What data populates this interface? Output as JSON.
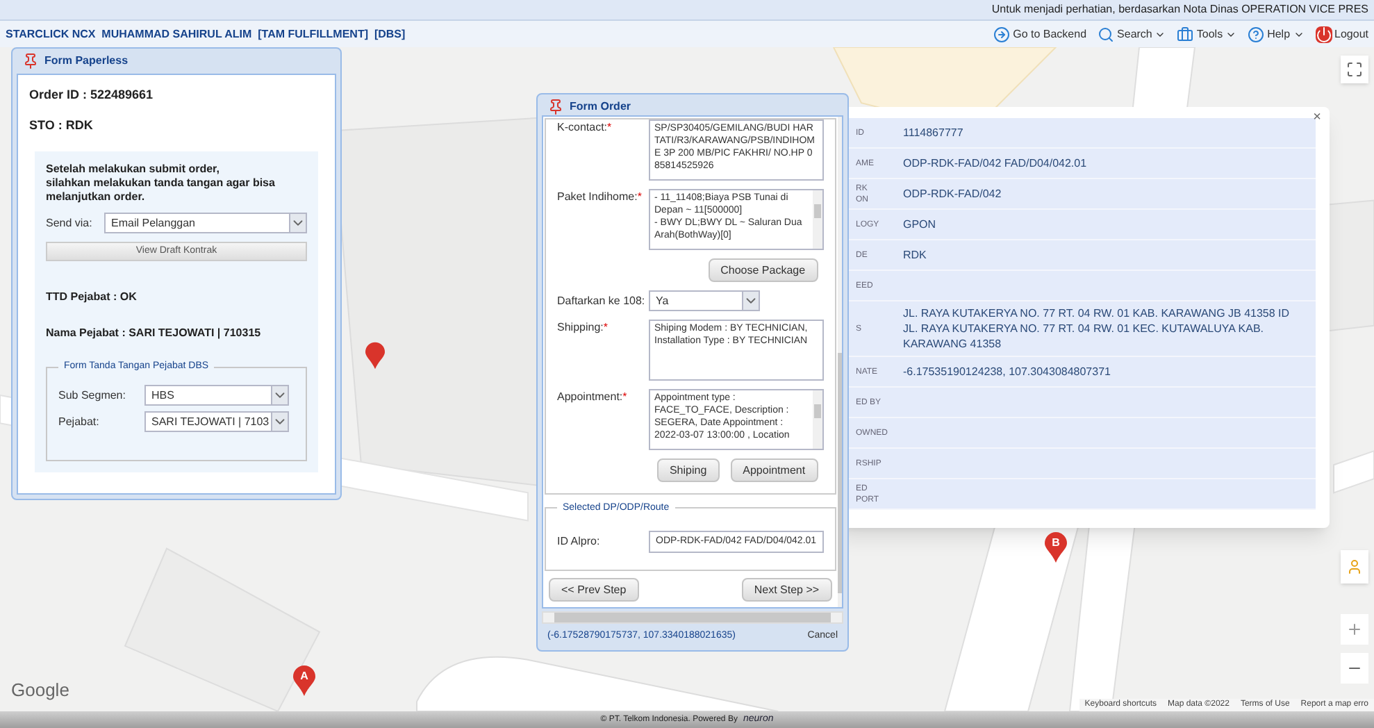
{
  "notice": "Untuk menjadi perhatian, berdasarkan Nota Dinas OPERATION VICE PRES",
  "header": {
    "title": "STARCLICK NCX  MUHAMMAD SAHIRUL ALIM  [TAM FULFILLMENT]  [DBS]",
    "toolbar": [
      {
        "label": "Go to Backend",
        "kind": "backend",
        "menu": false
      },
      {
        "label": "Search",
        "kind": "search",
        "menu": true
      },
      {
        "label": "Tools",
        "kind": "tools",
        "menu": true
      },
      {
        "label": "Help",
        "kind": "help",
        "menu": true
      },
      {
        "label": "Logout",
        "kind": "logout",
        "menu": false
      }
    ]
  },
  "form_paperless": {
    "title": "Form Paperless",
    "order_id": "Order ID : 522489661",
    "sto": "STO : RDK",
    "message": "Setelah melakukan submit order,\nsilahkan melakukan tanda tangan agar bisa\nmelanjutkan order.",
    "send_via": {
      "label": "Send via:",
      "value": "Email Pelanggan"
    },
    "view_button": "View Draft Kontrak",
    "ttd": "TTD Pejabat : OK",
    "nama": "Nama Pejabat : SARI TEJOWATI | 710315",
    "legend": "Form Tanda Tangan Pejabat DBS",
    "fields": [
      {
        "label": "Sub Segmen:",
        "value": "HBS"
      },
      {
        "label": "Pejabat:",
        "value": "SARI TEJOWATI | 7103"
      }
    ]
  },
  "form_order": {
    "title": "Form Order",
    "items": [
      {
        "kind": "textarea",
        "label": "K-contact:",
        "mark": "*",
        "value": "SP/SP30405/GEMILANG/BUDI HARTATI/R3/KARAWANG/PSB/INDIHOME 3P 200 MB/PIC FAKHRI/ NO.HP 085814525926"
      },
      {
        "kind": "scrollbox",
        "label": "Paket Indihome:",
        "mark": "*",
        "value": "- 11_11408;Biaya PSB Tunai di Depan ~ 11[500000]\n- BWY DL;BWY DL ~ Saluran Dua Arah(BothWay)[0]"
      },
      {
        "kind": "buttons",
        "buttons": [
          "Choose Package"
        ]
      },
      {
        "kind": "select",
        "label": "Daftarkan ke 108:",
        "value": "Ya"
      },
      {
        "kind": "textarea",
        "label": "Shipping:",
        "mark": "*",
        "value": "Shiping Modem : BY TECHNICIAN,\nInstallation Type : BY TECHNICIAN"
      },
      {
        "kind": "scrollbox",
        "label": "Appointment:",
        "mark": "*",
        "value": "Appointment type : FACE_TO_FACE, Description : SEGERA, Date Appointment : 2022-03-07 13:00:00 , Location"
      },
      {
        "kind": "buttons",
        "buttons": [
          "Shiping",
          "Appointment"
        ]
      }
    ],
    "route": {
      "legend": "Selected DP/ODP/Route",
      "label": "ID Alpro:",
      "value": "ODP-RDK-FAD/042 FAD/D04/042.01"
    },
    "prev": "<< Prev Step",
    "next": "Next Step >>",
    "coords": "(-6.17528790175737, 107.3340188021635)",
    "cancel": "Cancel"
  },
  "info_popup": {
    "close": "×",
    "rows": [
      {
        "label": "ID",
        "value": "1114867777"
      },
      {
        "label": "AME",
        "value": "ODP-RDK-FAD/042 FAD/D04/042.01"
      },
      {
        "label": "RK\nON",
        "value": "ODP-RDK-FAD/042"
      },
      {
        "label": "LOGY",
        "value": "GPON"
      },
      {
        "label": "DE",
        "value": "RDK"
      },
      {
        "label": "EED",
        "value": ""
      },
      {
        "label": "S",
        "value": "JL. RAYA KUTAKERYA NO. 77 RT. 04 RW. 01 KAB. KARAWANG JB 41358 ID JL. RAYA KUTAKERYA NO. 77 RT. 04 RW. 01 KEC. KUTAWALUYA KAB. KARAWANG 41358"
      },
      {
        "label": "NATE",
        "value": "-6.17535190124238, 107.3043084807371"
      },
      {
        "label": "ED BY",
        "value": ""
      },
      {
        "label": "OWNED",
        "value": ""
      },
      {
        "label": "RSHIP",
        "value": ""
      },
      {
        "label": "ED PORT",
        "value": ""
      }
    ]
  },
  "map": {
    "markers": [
      {
        "label": "A"
      },
      {
        "label": "B"
      }
    ],
    "logo": "Google",
    "attribution": [
      "Keyboard shortcuts",
      "Map data ©2022",
      "Terms of Use",
      "Report a map erro"
    ]
  },
  "footer": {
    "text": "© PT. Telkom Indonesia. Powered By",
    "brand": "neuron"
  }
}
